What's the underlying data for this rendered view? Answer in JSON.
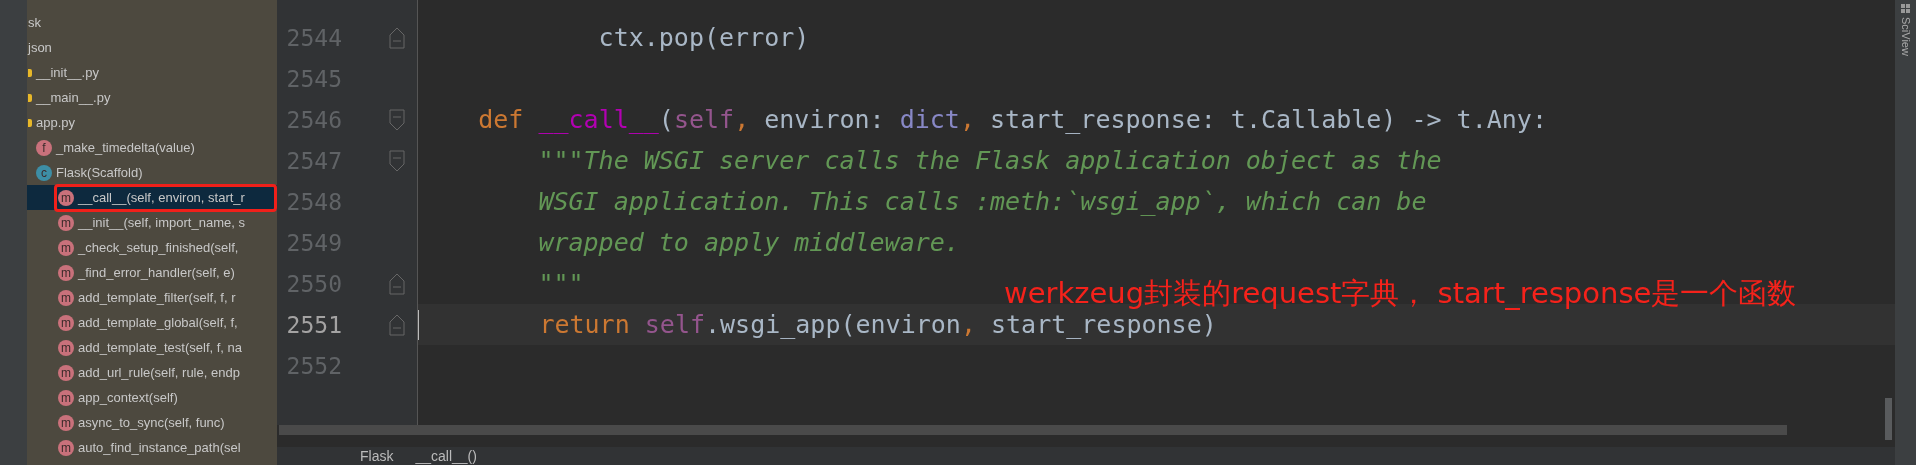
{
  "structure": {
    "items": [
      {
        "label": "sk",
        "kind": "folder",
        "selected": false
      },
      {
        "label": "json",
        "kind": "folder",
        "selected": false
      },
      {
        "label": "__init__.py",
        "kind": "file",
        "selected": false
      },
      {
        "label": "__main__.py",
        "kind": "file",
        "selected": false
      },
      {
        "label": "app.py",
        "kind": "file",
        "selected": false,
        "children": [
          {
            "label": "_make_timedelta(value)",
            "kind": "function",
            "badge": "f",
            "selected": false
          },
          {
            "label": "Flask(Scaffold)",
            "kind": "class",
            "badge": "c",
            "selected": false,
            "children": [
              {
                "label": "__call__(self, environ, start_r",
                "kind": "method",
                "badge": "m",
                "selected": true
              },
              {
                "label": "__init__(self, import_name, s",
                "kind": "method",
                "badge": "m",
                "selected": false
              },
              {
                "label": "_check_setup_finished(self,",
                "kind": "method",
                "badge": "m",
                "selected": false
              },
              {
                "label": "_find_error_handler(self, e)",
                "kind": "method",
                "badge": "m",
                "selected": false
              },
              {
                "label": "add_template_filter(self, f, r",
                "kind": "method",
                "badge": "m",
                "selected": false
              },
              {
                "label": "add_template_global(self, f,",
                "kind": "method",
                "badge": "m",
                "selected": false
              },
              {
                "label": "add_template_test(self, f, na",
                "kind": "method",
                "badge": "m",
                "selected": false
              },
              {
                "label": "add_url_rule(self, rule, endp",
                "kind": "method",
                "badge": "m",
                "selected": false
              },
              {
                "label": "app_context(self)",
                "kind": "method",
                "badge": "m",
                "selected": false
              },
              {
                "label": "async_to_sync(self, func)",
                "kind": "method",
                "badge": "m",
                "selected": false
              },
              {
                "label": "auto_find_instance_path(sel",
                "kind": "method",
                "badge": "m",
                "selected": false
              }
            ]
          }
        ]
      }
    ]
  },
  "editor": {
    "lines": [
      {
        "number": "2544",
        "current": false,
        "fold_end": true,
        "tokens": [
          {
            "text": "            ctx.pop(error)",
            "kind": "plain"
          }
        ]
      },
      {
        "number": "2545",
        "current": false
      },
      {
        "number": "2546",
        "current": false,
        "fold_start": true,
        "tokens": [
          {
            "text": "    def ",
            "kind": "keyword"
          },
          {
            "text": "__call__",
            "kind": "magic"
          },
          {
            "text": "(",
            "kind": "plain"
          },
          {
            "text": "self",
            "kind": "self"
          },
          {
            "text": ", ",
            "kind": "keyword"
          },
          {
            "text": "environ: ",
            "kind": "plain"
          },
          {
            "text": "dict",
            "kind": "builtin"
          },
          {
            "text": ", ",
            "kind": "keyword"
          },
          {
            "text": "start_response: t.Callable) -> t.Any:",
            "kind": "plain"
          }
        ]
      },
      {
        "number": "2547",
        "current": false,
        "fold_start": true,
        "tokens": [
          {
            "text": "        \"\"\"The WSGI server calls the Flask application object as the",
            "kind": "doc"
          }
        ]
      },
      {
        "number": "2548",
        "current": false,
        "tokens": [
          {
            "text": "        WSGI application. This calls :meth:`wsgi_app`, which can be",
            "kind": "doc"
          }
        ]
      },
      {
        "number": "2549",
        "current": false,
        "tokens": [
          {
            "text": "        wrapped to apply middleware.",
            "kind": "doc"
          }
        ]
      },
      {
        "number": "2550",
        "current": false,
        "fold_end": true,
        "tokens": [
          {
            "text": "        \"\"\"",
            "kind": "doc"
          }
        ]
      },
      {
        "number": "2551",
        "current": true,
        "fold_end": true,
        "tokens": [
          {
            "text": "        return ",
            "kind": "keyword"
          },
          {
            "text": "self",
            "kind": "self"
          },
          {
            "text": ".wsgi_app(environ",
            "kind": "plain"
          },
          {
            "text": ", ",
            "kind": "keyword"
          },
          {
            "text": "start_response)",
            "kind": "plain"
          }
        ]
      },
      {
        "number": "2552",
        "current": false
      }
    ],
    "annotation": "werkzeug封装的request字典， start_response是一个函数",
    "breadcrumbs": [
      "Flask",
      "__call__()"
    ]
  },
  "side_tab": "SciView"
}
